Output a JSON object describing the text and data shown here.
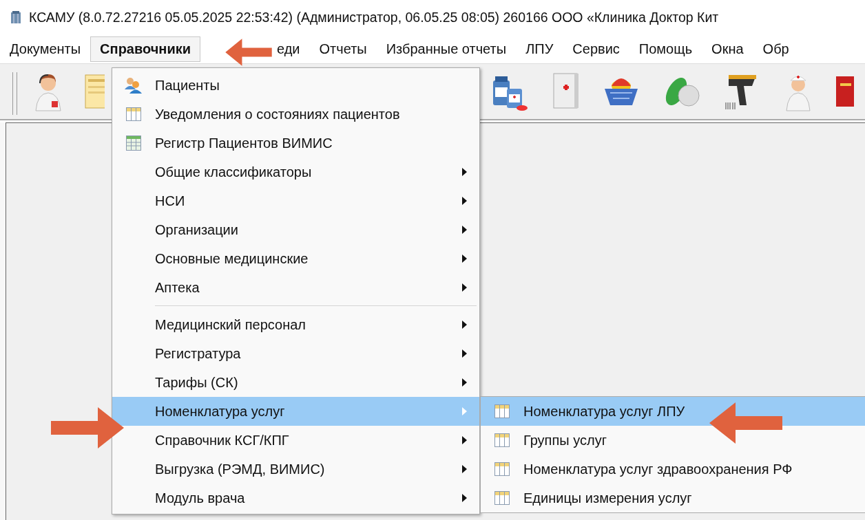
{
  "window": {
    "title": "КСАМУ (8.0.72.27216 05.05.2025 22:53:42) (Администратор, 06.05.25 08:05)  260166 ООО «Клиника Доктор Кит"
  },
  "menu_bar": [
    {
      "label": "Документы",
      "selected": false
    },
    {
      "label": "Справочники",
      "selected": true
    },
    {
      "label": "еди",
      "selected": false
    },
    {
      "label": "Отчеты",
      "selected": false
    },
    {
      "label": "Избранные отчеты",
      "selected": false
    },
    {
      "label": "ЛПУ",
      "selected": false
    },
    {
      "label": "Сервис",
      "selected": false
    },
    {
      "label": "Помощь",
      "selected": false
    },
    {
      "label": "Окна",
      "selected": false
    },
    {
      "label": "Обр",
      "selected": false
    }
  ],
  "dropdown": {
    "items": [
      {
        "kind": "people",
        "label": "Пациенты",
        "selected": false
      },
      {
        "kind": "table",
        "label": "Уведомления о состояниях пациентов",
        "selected": false
      },
      {
        "kind": "register",
        "label": "Регистр Пациентов ВИМИС",
        "selected": false
      },
      {
        "kind": "submenu",
        "label": "Общие классификаторы",
        "selected": false
      },
      {
        "kind": "submenu",
        "label": "НСИ",
        "selected": false
      },
      {
        "kind": "submenu",
        "label": "Организации",
        "selected": false
      },
      {
        "kind": "submenu",
        "label": "Основные медицинские",
        "selected": false
      },
      {
        "kind": "submenu",
        "label": "Аптека",
        "selected": false
      },
      {
        "kind": "separator"
      },
      {
        "kind": "submenu",
        "label": "Медицинский персонал",
        "selected": false
      },
      {
        "kind": "submenu",
        "label": "Регистратура",
        "selected": false
      },
      {
        "kind": "submenu",
        "label": "Тарифы (СК)",
        "selected": false
      },
      {
        "kind": "submenu",
        "label": "Номенклатура услуг",
        "selected": true
      },
      {
        "kind": "submenu",
        "label": "Справочник КСГ/КПГ",
        "selected": false
      },
      {
        "kind": "submenu",
        "label": "Выгрузка (РЭМД, ВИМИС)",
        "selected": false
      },
      {
        "kind": "submenu",
        "label": "Модуль врача",
        "selected": false
      }
    ]
  },
  "submenu": {
    "items": [
      {
        "label": "Номенклатура услуг ЛПУ",
        "selected": true
      },
      {
        "label": "Группы услуг",
        "selected": false
      },
      {
        "label": "Номенклатура услуг здравоохранения РФ",
        "selected": false
      },
      {
        "label": "Единицы измерения услуг",
        "selected": false
      }
    ]
  }
}
